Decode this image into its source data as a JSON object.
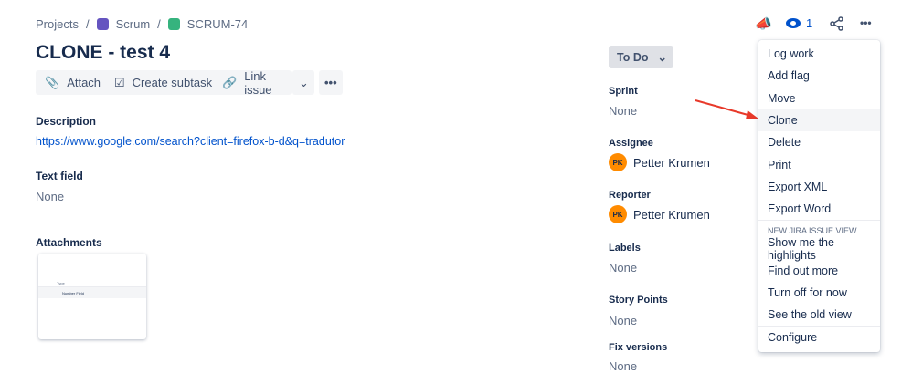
{
  "breadcrumb": {
    "projects": "Projects",
    "sep": "/",
    "project": "Scrum",
    "issue": "SCRUM-74"
  },
  "title": "CLONE - test 4",
  "toolbar": {
    "attach": "Attach",
    "create_subtask": "Create subtask",
    "link_issue": "Link issue"
  },
  "header_actions": {
    "watch_count": "1"
  },
  "description": {
    "label": "Description",
    "link": "https://www.google.com/search?client=firefox-b-d&q=tradutor"
  },
  "text_field": {
    "label": "Text field",
    "value": "None"
  },
  "attachments": {
    "label": "Attachments",
    "thumb_header": "Type",
    "thumb_row": "Number Field"
  },
  "status": "To Do",
  "fields": {
    "sprint": {
      "label": "Sprint",
      "value": "None"
    },
    "assignee": {
      "label": "Assignee",
      "initials": "PK",
      "value": "Petter Krumen"
    },
    "reporter": {
      "label": "Reporter",
      "initials": "PK",
      "value": "Petter Krumen"
    },
    "labels": {
      "label": "Labels",
      "value": "None"
    },
    "story_points": {
      "label": "Story Points",
      "value": "None"
    },
    "fix_versions": {
      "label": "Fix versions",
      "value": "None"
    }
  },
  "menu": {
    "items": [
      "Log work",
      "Add flag",
      "Move",
      "Clone",
      "Delete",
      "Print",
      "Export XML",
      "Export Word"
    ],
    "section": "NEW JIRA ISSUE VIEW",
    "items2": [
      "Show me the highlights",
      "Find out more",
      "Turn off for now",
      "See the old view"
    ],
    "configure": "Configure"
  },
  "colors": {
    "accent": "#0052cc",
    "arrow": "#e8392a",
    "avatar": "#ff8b00"
  }
}
